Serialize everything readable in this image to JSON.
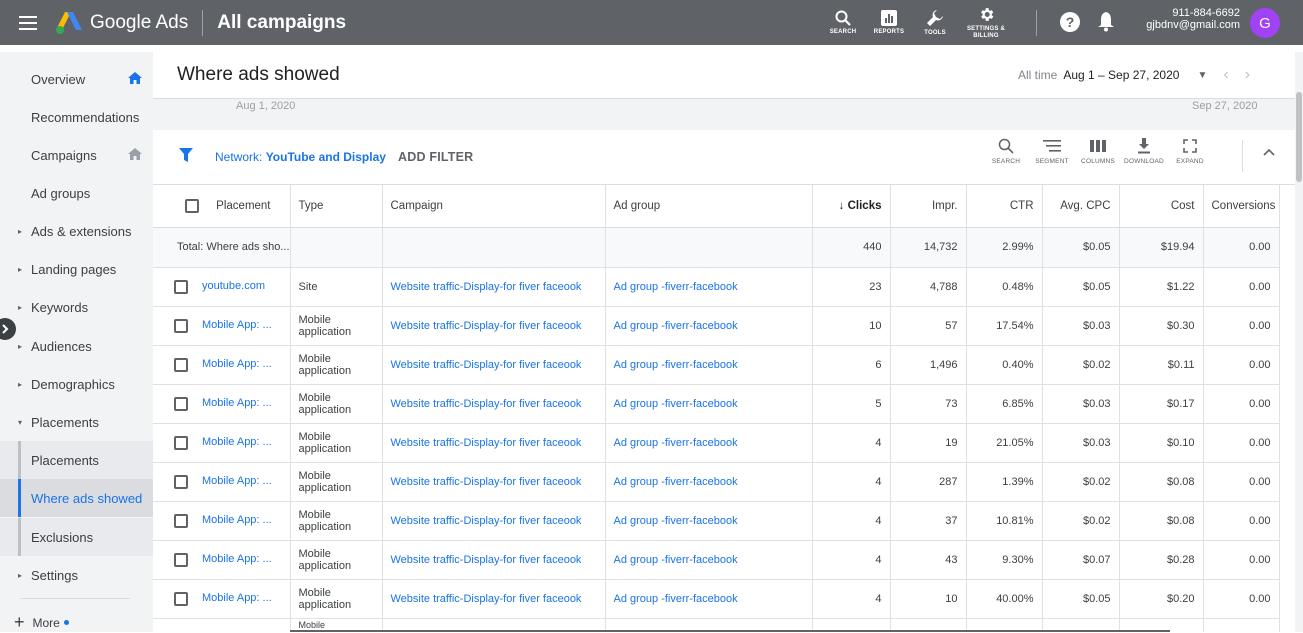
{
  "topbar": {
    "product": "Google Ads",
    "page_title": "All campaigns",
    "tools": [
      {
        "label": "SEARCH",
        "icon": "search-icon"
      },
      {
        "label": "REPORTS",
        "icon": "reports-icon"
      },
      {
        "label": "TOOLS",
        "icon": "wrench-icon"
      },
      {
        "label": "SETTINGS & BILLING",
        "icon": "gear-icon"
      }
    ],
    "phone": "911-884-6692",
    "email": "gjbdnv@gmail.com",
    "avatar_letter": "G",
    "avatar_color": "#a142f4"
  },
  "nav": {
    "items": [
      {
        "label": "Overview",
        "home": true,
        "home_color": "#1a73e8"
      },
      {
        "label": "Recommendations"
      },
      {
        "label": "Campaigns",
        "home": true,
        "home_color": "#9aa0a6"
      },
      {
        "label": "Ad groups"
      },
      {
        "label": "Ads & extensions",
        "caret": "▸"
      },
      {
        "label": "Landing pages",
        "caret": "▸"
      },
      {
        "label": "Keywords",
        "caret": "▸"
      },
      {
        "label": "Audiences",
        "caret": "▸"
      },
      {
        "label": "Demographics",
        "caret": "▸"
      },
      {
        "label": "Placements",
        "caret": "▾"
      },
      {
        "label": "Placements",
        "sub": true
      },
      {
        "label": "Where ads showed",
        "sub": true,
        "active": true
      },
      {
        "label": "Exclusions",
        "sub": true
      },
      {
        "label": "Settings",
        "caret": "▸"
      }
    ],
    "more_label": "More"
  },
  "header": {
    "title": "Where ads showed",
    "date_label": "All time",
    "date_value": "Aug 1 – Sep 27, 2020",
    "timeline_start": "Aug 1, 2020",
    "timeline_end": "Sep 27, 2020"
  },
  "filter": {
    "network_key": "Network:",
    "network_value": "YouTube and Display",
    "add_filter": "ADD FILTER",
    "tools": [
      {
        "label": "SEARCH",
        "icon": "search-icon"
      },
      {
        "label": "SEGMENT",
        "icon": "segment-icon"
      },
      {
        "label": "COLUMNS",
        "icon": "columns-icon"
      },
      {
        "label": "DOWNLOAD",
        "icon": "download-icon"
      },
      {
        "label": "EXPAND",
        "icon": "expand-icon"
      }
    ]
  },
  "table": {
    "headers": {
      "placement": "Placement",
      "type": "Type",
      "campaign": "Campaign",
      "ad_group": "Ad group",
      "clicks": "Clicks",
      "impr": "Impr.",
      "ctr": "CTR",
      "avg_cpc": "Avg. CPC",
      "cost": "Cost",
      "conversions": "Conversions"
    },
    "total": {
      "label": "Total: Where ads sho...",
      "clicks": "440",
      "impr": "14,732",
      "ctr": "2.99%",
      "avg_cpc": "$0.05",
      "cost": "$19.94",
      "conversions": "0.00"
    },
    "rows": [
      {
        "placement": "youtube.com",
        "type1": "Site",
        "type2": "",
        "campaign": "Website traffic-Display-for fiver faceook",
        "ad_group": "Ad group -fiverr-facebook",
        "clicks": "23",
        "impr": "4,788",
        "ctr": "0.48%",
        "avg_cpc": "$0.05",
        "cost": "$1.22",
        "conversions": "0.00"
      },
      {
        "placement": "Mobile App: ...",
        "type1": "Mobile",
        "type2": "application",
        "campaign": "Website traffic-Display-for fiver faceook",
        "ad_group": "Ad group -fiverr-facebook",
        "clicks": "10",
        "impr": "57",
        "ctr": "17.54%",
        "avg_cpc": "$0.03",
        "cost": "$0.30",
        "conversions": "0.00"
      },
      {
        "placement": "Mobile App: ...",
        "type1": "Mobile",
        "type2": "application",
        "campaign": "Website traffic-Display-for fiver faceook",
        "ad_group": "Ad group -fiverr-facebook",
        "clicks": "6",
        "impr": "1,496",
        "ctr": "0.40%",
        "avg_cpc": "$0.02",
        "cost": "$0.11",
        "conversions": "0.00"
      },
      {
        "placement": "Mobile App: ...",
        "type1": "Mobile",
        "type2": "application",
        "campaign": "Website traffic-Display-for fiver faceook",
        "ad_group": "Ad group -fiverr-facebook",
        "clicks": "5",
        "impr": "73",
        "ctr": "6.85%",
        "avg_cpc": "$0.03",
        "cost": "$0.17",
        "conversions": "0.00"
      },
      {
        "placement": "Mobile App: ...",
        "type1": "Mobile",
        "type2": "application",
        "campaign": "Website traffic-Display-for fiver faceook",
        "ad_group": "Ad group -fiverr-facebook",
        "clicks": "4",
        "impr": "19",
        "ctr": "21.05%",
        "avg_cpc": "$0.03",
        "cost": "$0.10",
        "conversions": "0.00"
      },
      {
        "placement": "Mobile App: ...",
        "type1": "Mobile",
        "type2": "application",
        "campaign": "Website traffic-Display-for fiver faceook",
        "ad_group": "Ad group -fiverr-facebook",
        "clicks": "4",
        "impr": "287",
        "ctr": "1.39%",
        "avg_cpc": "$0.02",
        "cost": "$0.08",
        "conversions": "0.00"
      },
      {
        "placement": "Mobile App: ...",
        "type1": "Mobile",
        "type2": "application",
        "campaign": "Website traffic-Display-for fiver faceook",
        "ad_group": "Ad group -fiverr-facebook",
        "clicks": "4",
        "impr": "37",
        "ctr": "10.81%",
        "avg_cpc": "$0.02",
        "cost": "$0.08",
        "conversions": "0.00"
      },
      {
        "placement": "Mobile App: ...",
        "type1": "Mobile",
        "type2": "application",
        "campaign": "Website traffic-Display-for fiver faceook",
        "ad_group": "Ad group -fiverr-facebook",
        "clicks": "4",
        "impr": "43",
        "ctr": "9.30%",
        "avg_cpc": "$0.07",
        "cost": "$0.28",
        "conversions": "0.00"
      },
      {
        "placement": "Mobile App: ...",
        "type1": "Mobile",
        "type2": "application",
        "campaign": "Website traffic-Display-for fiver faceook",
        "ad_group": "Ad group -fiverr-facebook",
        "clicks": "4",
        "impr": "10",
        "ctr": "40.00%",
        "avg_cpc": "$0.05",
        "cost": "$0.20",
        "conversions": "0.00"
      }
    ],
    "partial_type": "Mobile"
  }
}
